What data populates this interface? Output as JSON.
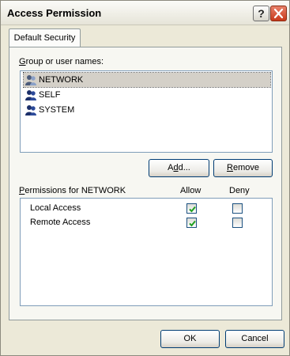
{
  "window": {
    "title": "Access Permission",
    "help_icon": "help-question-icon",
    "close_icon": "close-x-icon"
  },
  "tabs": [
    {
      "label": "Default Security",
      "selected": true
    }
  ],
  "groups": {
    "label": "Group or user names:",
    "label_accel": "G",
    "label_rest": "roup or user names:",
    "items": [
      {
        "name": "NETWORK",
        "icon": "users-group-icon",
        "selected": true
      },
      {
        "name": "SELF",
        "icon": "users-group-icon",
        "selected": false
      },
      {
        "name": "SYSTEM",
        "icon": "users-group-icon",
        "selected": false
      }
    ]
  },
  "buttons": {
    "add_pre": "A",
    "add_accel": "d",
    "add_post": "d...",
    "remove_accel": "R",
    "remove_post": "emove",
    "ok": "OK",
    "cancel": "Cancel"
  },
  "permissions": {
    "header_pre": "",
    "header_accel": "P",
    "header_post": "ermissions for NETWORK",
    "allow_label": "Allow",
    "deny_label": "Deny",
    "rows": [
      {
        "name": "Local Access",
        "allow": true,
        "deny": false
      },
      {
        "name": "Remote Access",
        "allow": true,
        "deny": false
      }
    ]
  },
  "colors": {
    "check": "#21a121",
    "selection": "#d4d0c8",
    "close_button": "#c8391a"
  }
}
